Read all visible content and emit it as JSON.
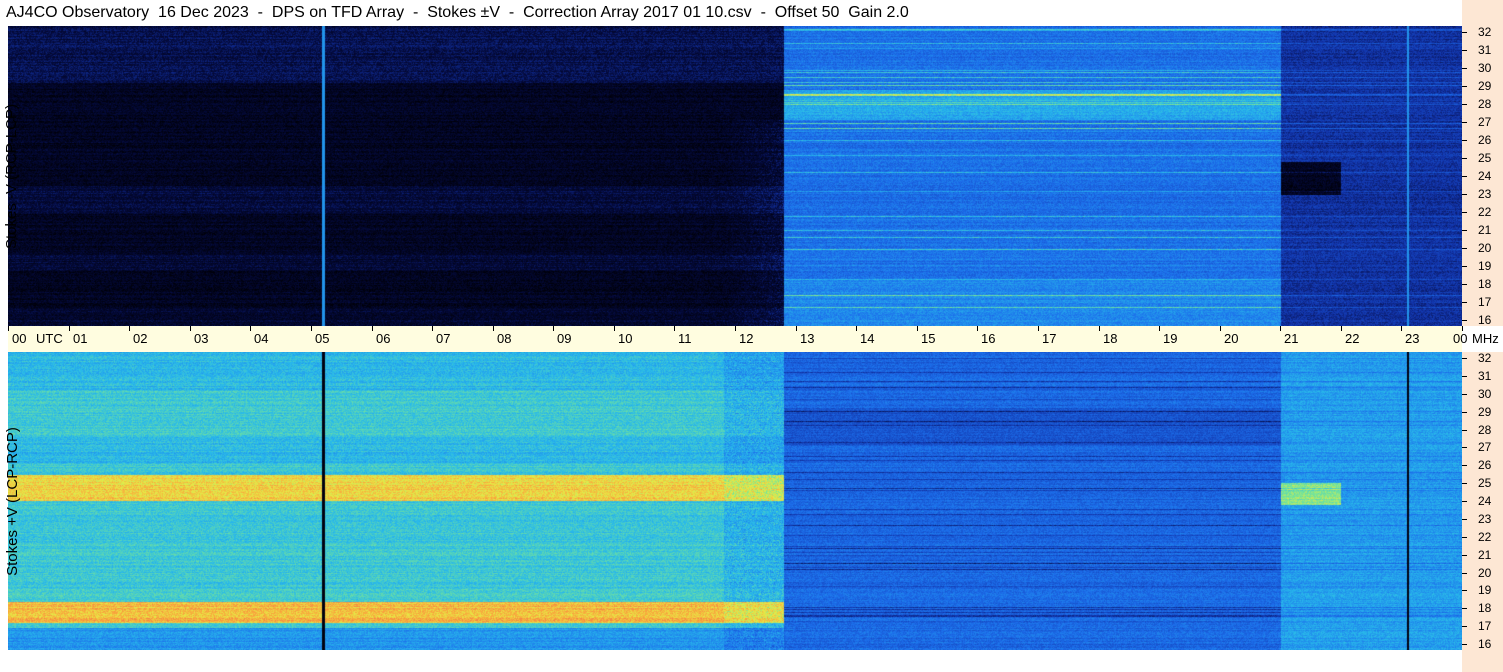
{
  "title": "AJ4CO Observatory  16 Dec 2023  -  DPS on TFD Array  -  Stokes ±V  -  Correction Array 2017 01 10.csv  -  Offset 50  Gain 2.0",
  "chart_data": [
    {
      "type": "heatmap",
      "panel": "top",
      "ylabel": "Stokes -V (RCP-LCP)",
      "x_range_utc_hours": [
        0,
        24
      ],
      "y_range_mhz": [
        16,
        32
      ],
      "yticks": [
        "32",
        "31",
        "30",
        "29",
        "28",
        "27",
        "26",
        "25",
        "24",
        "23",
        "22",
        "21",
        "20",
        "19",
        "18",
        "17",
        "16"
      ],
      "regions": [
        {
          "start_utc": 0.0,
          "end_utc": 12.8,
          "level": "very low (dark blue / black)"
        },
        {
          "start_utc": 12.8,
          "end_utc": 21.0,
          "level": "medium (blue)"
        },
        {
          "start_utc": 21.0,
          "end_utc": 24.0,
          "level": "low (dark blue)"
        }
      ],
      "vertical_lines_utc": [
        5.2,
        23.1
      ]
    },
    {
      "type": "heatmap",
      "panel": "bottom",
      "ylabel": "Stokes +V (LCP-RCP)",
      "x_range_utc_hours": [
        0,
        24
      ],
      "y_range_mhz": [
        16,
        32
      ],
      "yticks": [
        "32",
        "31",
        "30",
        "29",
        "28",
        "27",
        "26",
        "25",
        "24",
        "23",
        "22",
        "21",
        "20",
        "19",
        "18",
        "17",
        "16"
      ],
      "regions": [
        {
          "start_utc": 0.0,
          "end_utc": 12.8,
          "level": "high (cyan / yellow, orange bands near 25 and 18 MHz)"
        },
        {
          "start_utc": 12.8,
          "end_utc": 21.0,
          "level": "medium (blue)"
        },
        {
          "start_utc": 21.0,
          "end_utc": 24.0,
          "level": "medium-high (light blue)"
        }
      ],
      "vertical_lines_utc": [
        5.2,
        23.1
      ]
    }
  ],
  "time_axis": {
    "labels": [
      "00",
      "01",
      "02",
      "03",
      "04",
      "05",
      "06",
      "07",
      "08",
      "09",
      "10",
      "11",
      "12",
      "13",
      "14",
      "15",
      "16",
      "17",
      "18",
      "19",
      "20",
      "21",
      "22",
      "23",
      "00"
    ],
    "utc_label": "UTC",
    "mhz_label": "MHz"
  },
  "colors": {
    "background": "#ffffff",
    "freq_strip": "#fde7d4",
    "time_strip": "#fffde0"
  }
}
